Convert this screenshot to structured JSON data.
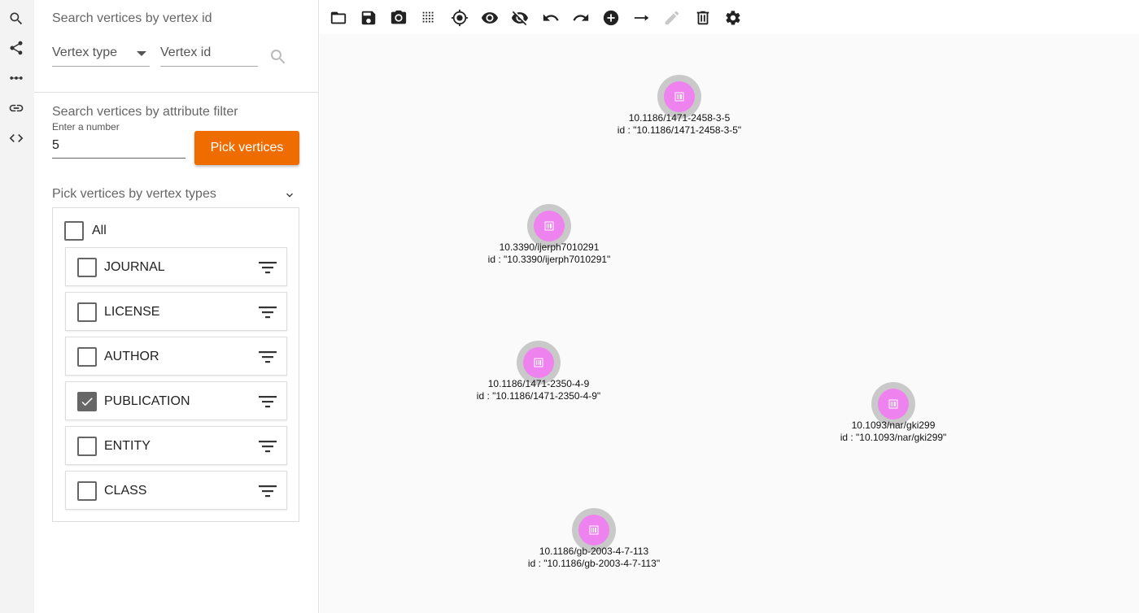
{
  "rail": {
    "icons": [
      "search-icon",
      "share-icon",
      "more-horiz-icon",
      "link-icon",
      "code-icon"
    ]
  },
  "search_by_id": {
    "title": "Search vertices by vertex id",
    "vertex_type_label": "Vertex type",
    "vertex_id_label": "Vertex id"
  },
  "attribute_filter": {
    "title": "Search vertices by attribute filter",
    "number_label": "Enter a number",
    "number_value": "5",
    "pick_button": "Pick vertices"
  },
  "vertex_types": {
    "title": "Pick vertices by vertex types",
    "all_label": "All",
    "all_checked": false,
    "items": [
      {
        "label": "JOURNAL",
        "checked": false
      },
      {
        "label": "LICENSE",
        "checked": false
      },
      {
        "label": "AUTHOR",
        "checked": false
      },
      {
        "label": "PUBLICATION",
        "checked": true
      },
      {
        "label": "ENTITY",
        "checked": false
      },
      {
        "label": "CLASS",
        "checked": false
      }
    ]
  },
  "toolbar": {
    "icons": [
      "folder-open-icon",
      "save-icon",
      "camera-icon",
      "grid-icon",
      "locate-icon",
      "show-icon",
      "hide-icon",
      "undo-icon",
      "redo-icon",
      "add-vertex-icon",
      "add-edge-icon",
      "edit-icon",
      "delete-icon",
      "settings-icon"
    ]
  },
  "vertices": [
    {
      "name": "10.1186/1471-2458-3-5",
      "id_line": "id : \"10.1186/1471-2458-3-5\""
    },
    {
      "name": "10.3390/ijerph7010291",
      "id_line": "id : \"10.3390/ijerph7010291\""
    },
    {
      "name": "10.1186/1471-2350-4-9",
      "id_line": "id : \"10.1186/1471-2350-4-9\""
    },
    {
      "name": "10.1093/nar/gki299",
      "id_line": "id : \"10.1093/nar/gki299\""
    },
    {
      "name": "10.1186/gb-2003-4-7-113",
      "id_line": "id : \"10.1186/gb-2003-4-7-113\""
    }
  ],
  "colors": {
    "accent": "#ef6c00",
    "vertex_fill": "#ee82ee",
    "vertex_ring": "#c9c9c9"
  }
}
